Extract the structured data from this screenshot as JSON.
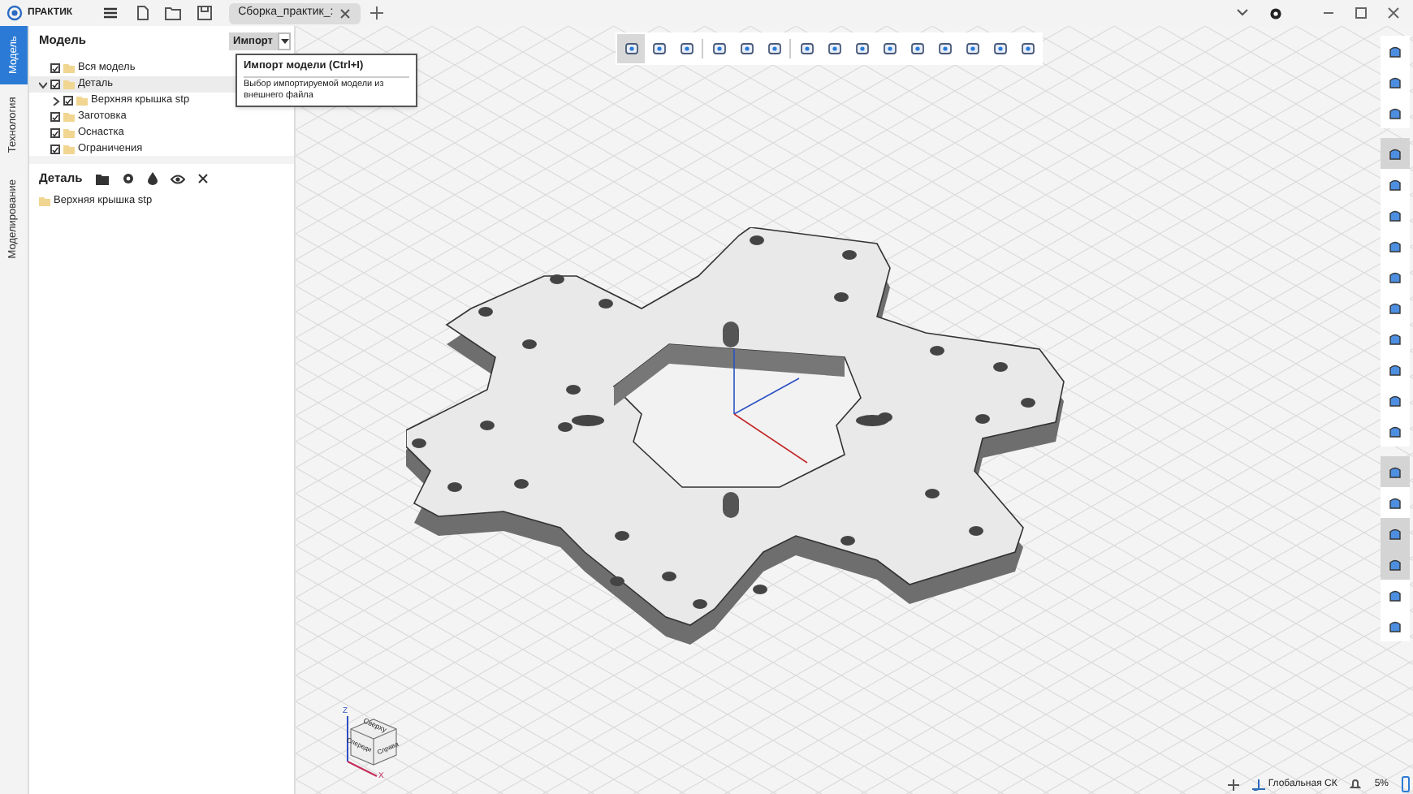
{
  "app": {
    "name": "ПРАКТИК"
  },
  "tabs": [
    {
      "label": "Сборка_практик_:",
      "selected": true
    }
  ],
  "side_tabs": [
    {
      "label": "Модель",
      "selected": true
    },
    {
      "label": "Технология",
      "selected": false
    },
    {
      "label": "Моделирование",
      "selected": false
    }
  ],
  "model_panel": {
    "title": "Модель",
    "import_button": "Импорт",
    "tree": [
      {
        "label": "Вся модель",
        "checked": true,
        "selected": false
      },
      {
        "label": "Деталь",
        "checked": true,
        "selected": true,
        "expanded": true,
        "children": [
          {
            "label": "Верхняя крышка stp",
            "checked": true,
            "selected": false,
            "expanded": false
          }
        ]
      },
      {
        "label": "Заготовка",
        "checked": true,
        "selected": false
      },
      {
        "label": "Оснастка",
        "checked": true,
        "selected": false
      },
      {
        "label": "Ограничения",
        "checked": true,
        "selected": false
      }
    ]
  },
  "tooltip": {
    "title": "Импорт модели (Ctrl+I)",
    "text": "Выбор импортируемой модели из внешнего файла"
  },
  "detail_panel": {
    "title": "Деталь",
    "items": [
      "Верхняя крышка stp"
    ]
  },
  "top_toolbar": [
    {
      "kind": "tool",
      "selected": true
    },
    {
      "kind": "tool",
      "selected": false
    },
    {
      "kind": "tool",
      "selected": false
    },
    {
      "kind": "separator"
    },
    {
      "kind": "tool",
      "selected": false
    },
    {
      "kind": "tool",
      "selected": false
    },
    {
      "kind": "tool",
      "selected": false
    },
    {
      "kind": "separator"
    },
    {
      "kind": "tool",
      "selected": false
    },
    {
      "kind": "tool",
      "selected": false
    },
    {
      "kind": "tool",
      "selected": false
    },
    {
      "kind": "tool",
      "selected": false
    },
    {
      "kind": "tool",
      "selected": false
    },
    {
      "kind": "tool",
      "selected": false
    },
    {
      "kind": "tool",
      "selected": false
    },
    {
      "kind": "tool",
      "selected": false
    },
    {
      "kind": "tool",
      "selected": false
    }
  ],
  "right_toolbar": [
    [
      {
        "selected": false
      },
      {
        "selected": false
      },
      {
        "selected": false
      }
    ],
    [
      {
        "selected": true
      },
      {
        "selected": false
      },
      {
        "selected": false
      },
      {
        "selected": false
      },
      {
        "selected": false
      },
      {
        "selected": false
      },
      {
        "selected": false
      },
      {
        "selected": false
      },
      {
        "selected": false
      },
      {
        "selected": false
      }
    ],
    [
      {
        "selected": true
      },
      {
        "selected": false
      },
      {
        "selected": true
      },
      {
        "selected": true
      },
      {
        "selected": false
      },
      {
        "selected": false
      }
    ]
  ],
  "view_cube": {
    "top": "Сверху",
    "front": "Спереди",
    "right": "Справа",
    "axis_z": "Z",
    "axis_x": "X"
  },
  "status_bar": {
    "coordinate_system": "Глобальная СК",
    "zoom": "5%"
  }
}
